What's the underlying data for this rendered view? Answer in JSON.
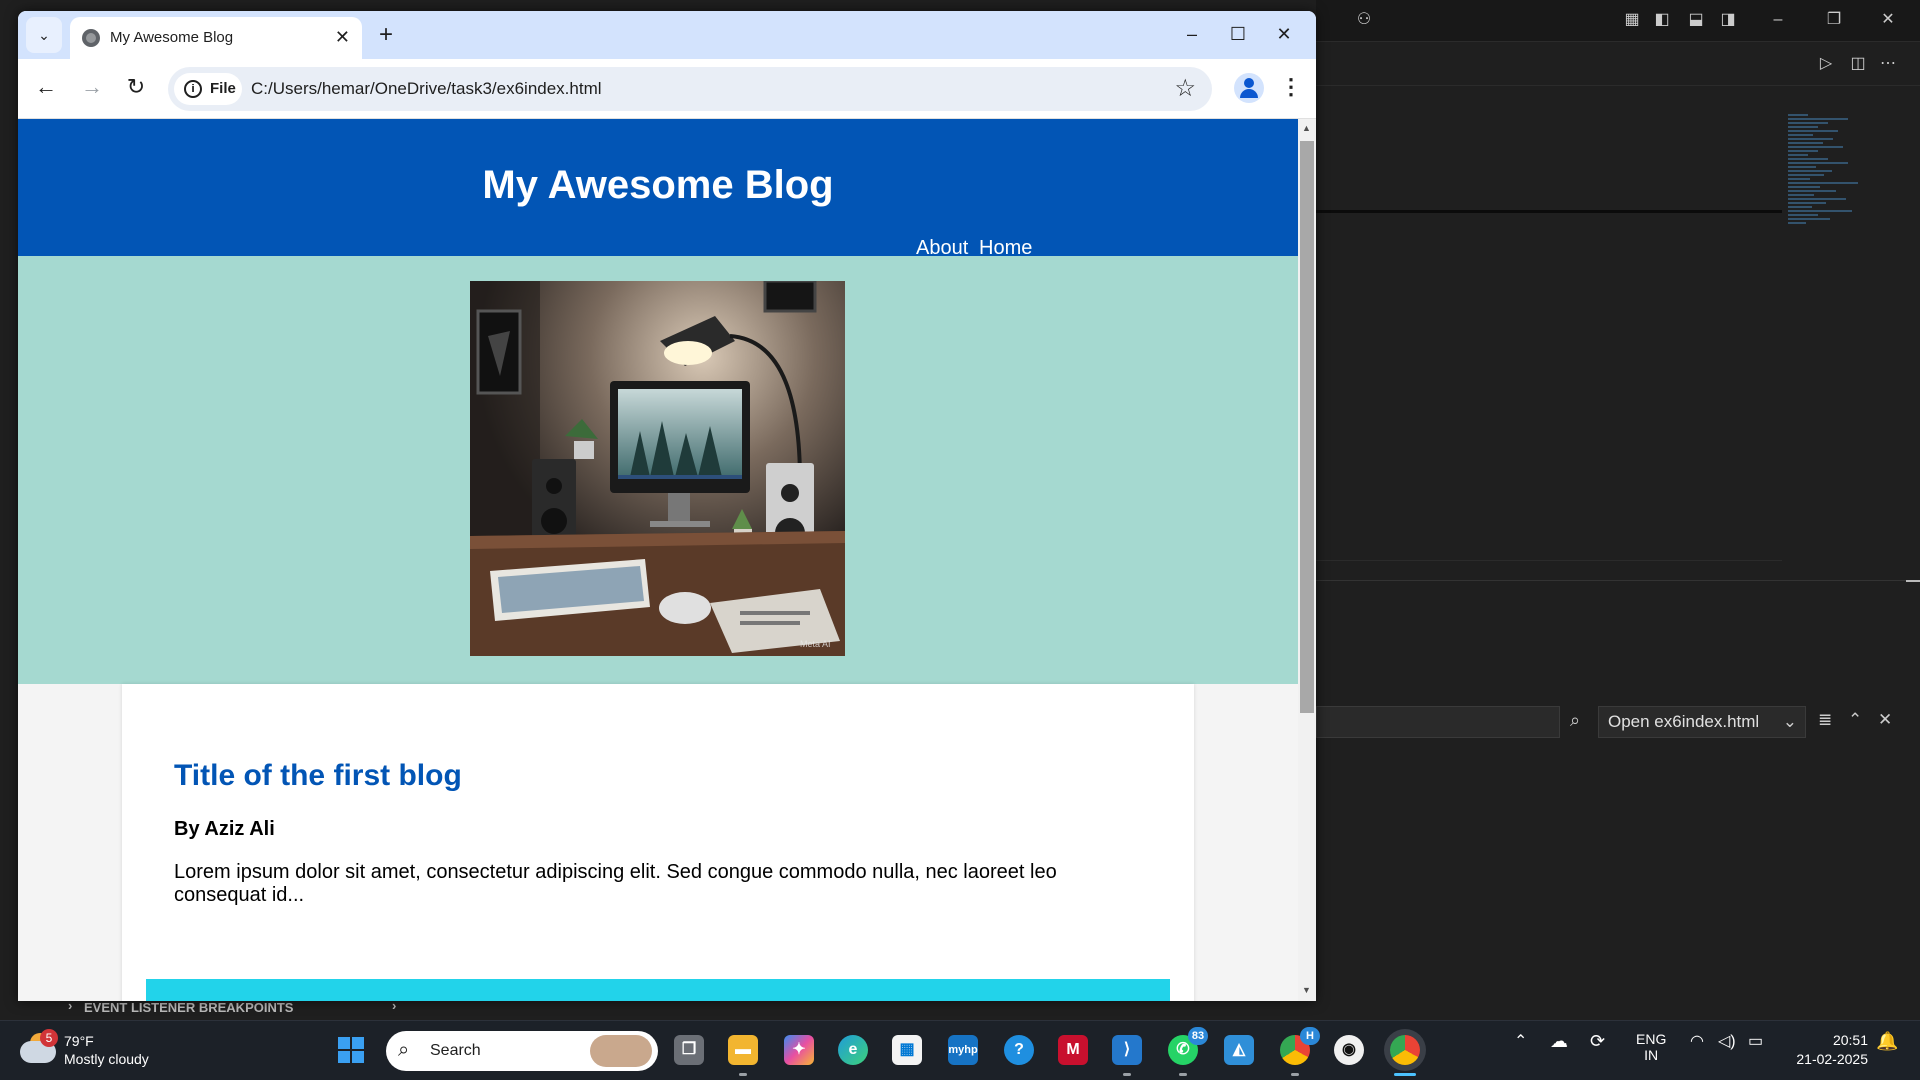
{
  "browser": {
    "tab_title": "My Awesome Blog",
    "new_tab_label": "+",
    "url_scheme_label": "File",
    "url": "C:/Users/hemar/OneDrive/task3/ex6index.html"
  },
  "page": {
    "blog_title": "My Awesome Blog",
    "nav": [
      "About",
      "Home"
    ],
    "post": {
      "title": "Title of the first blog",
      "author": "By Aziz Ali",
      "excerpt": "Lorem ipsum dolor sit amet, consectetur adipiscing elit. Sed congue commodo nulla, nec laoreet leo consequat id..."
    },
    "hero_watermark": "Meta AI",
    "colors": {
      "header": "#0255b5",
      "hero_bg": "#a5d9d0",
      "post_title": "#0255b5",
      "accent_bar": "#22d3ea"
    }
  },
  "vscode": {
    "find_dropdown_value": "Open ex6index.html",
    "panel_section": "EVENT LISTENER BREAKPOINTS"
  },
  "taskbar": {
    "weather_badge": "5",
    "temperature": "79°F",
    "condition": "Mostly cloudy",
    "search_label": "Search",
    "whatsapp_badge": "83",
    "chrome_profile_badge": "H",
    "language": "ENG",
    "region": "IN",
    "time": "20:51",
    "date": "21-02-2025"
  }
}
